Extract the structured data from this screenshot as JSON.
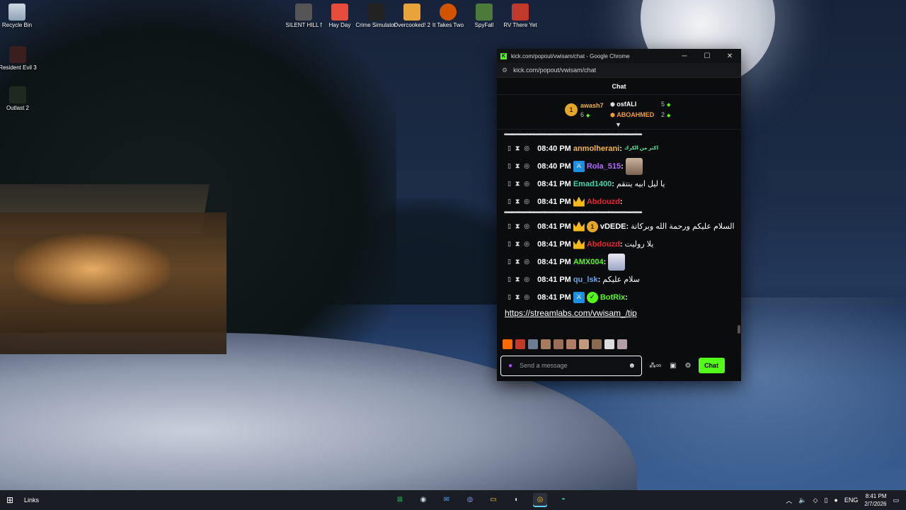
{
  "desktop": {
    "icons": [
      {
        "label": "Recycle Bin"
      },
      {
        "label": "Resident Evil 3"
      },
      {
        "label": "Outlast 2"
      },
      {
        "label": "SILENT HILL f"
      },
      {
        "label": "Hay Day"
      },
      {
        "label": "Crime Simulator"
      },
      {
        "label": "Overcooked! 2"
      },
      {
        "label": "It Takes Two"
      },
      {
        "label": "SpyFall"
      },
      {
        "label": "RV There Yet"
      }
    ]
  },
  "window": {
    "title": "kick.com/popout/vwisam/chat - Google Chrome",
    "url": "kick.com/popout/vwisam/chat",
    "minimize": "─",
    "maximize": "☐",
    "close": "✕"
  },
  "chat": {
    "header": "Chat",
    "leaderboard": {
      "first": {
        "rank": "1",
        "user": "awash7",
        "count": "6"
      },
      "second": {
        "user": "osfALI",
        "count": "5"
      },
      "third": {
        "user": "ABOAHMED",
        "count": "2"
      }
    },
    "divider_text": "********************************************************************************************",
    "messages": [
      {
        "time": "08:40 PM",
        "user": "anmolherani",
        "text": "",
        "emote_text": "اكثر من الكرك"
      },
      {
        "time": "08:40 PM",
        "user": "Rola_515",
        "text": ""
      },
      {
        "time": "08:41 PM",
        "user": "Emad1400",
        "text": "يا ليل ابيه ينتقم"
      },
      {
        "time": "08:41 PM",
        "user": "Abdouzd",
        "text": ""
      },
      {
        "time": "08:41 PM",
        "user": "vDEDE",
        "text": "السلام عليكم ورحمة الله وبركاتة",
        "sub_badge": "1"
      },
      {
        "time": "08:41 PM",
        "user": "Abdouzd",
        "text": "يلا روليت"
      },
      {
        "time": "08:41 PM",
        "user": "AMX004",
        "text": ""
      },
      {
        "time": "08:41 PM",
        "user": "qu_lsk",
        "text": "سلام عليكم"
      },
      {
        "time": "08:41 PM",
        "user": "BotRix",
        "text": ""
      }
    ],
    "link": "https://streamlabs.com/vwisam_/tip",
    "input_placeholder": "Send a message",
    "send_label": "Chat"
  },
  "colors": {
    "kick_green": "#53fc18",
    "gold": "#f0b34a",
    "anmolherani": "#f4b350",
    "Rola_515": "#b26bff",
    "Emad1400": "#3fd6a8",
    "Abdouzd": "#e0262f",
    "vDEDE": "#ffffff",
    "AMX004": "#53fc18",
    "qu_lsk": "#5fa8f5",
    "BotRix": "#53fc18"
  },
  "taskbar": {
    "links_label": "Links",
    "language": "ENG",
    "time": "8:41 PM",
    "date": "2/7/2026"
  }
}
